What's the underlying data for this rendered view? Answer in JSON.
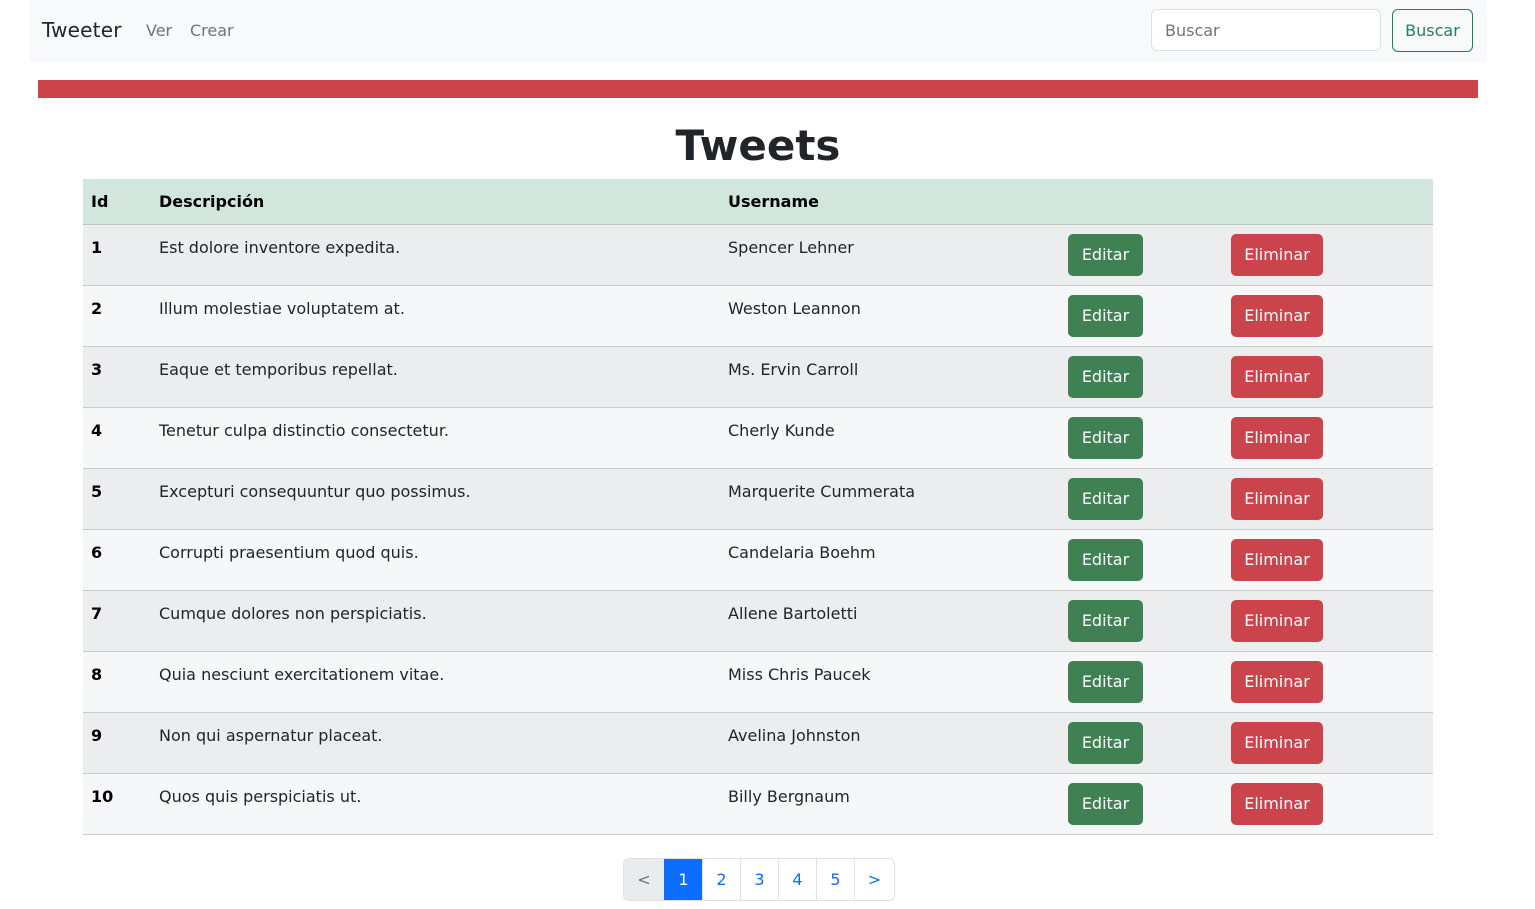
{
  "navbar": {
    "brand": "Tweeter",
    "links": [
      "Ver",
      "Crear"
    ],
    "search_placeholder": "Buscar",
    "search_button": "Buscar"
  },
  "colors": {
    "alert_bar": "#cc444b",
    "header_row": "#d3e6dd",
    "edit_button": "#3f8152",
    "delete_button": "#cc444b",
    "page_active": "#0d6efd"
  },
  "page_title": "Tweets",
  "table": {
    "headers": [
      "Id",
      "Descripción",
      "Username",
      "",
      ""
    ],
    "rows": [
      {
        "id": "1",
        "descripcion": "Est dolore inventore expedita.",
        "username": "Spencer Lehner",
        "edit": "Editar",
        "delete": "Eliminar"
      },
      {
        "id": "2",
        "descripcion": "Illum molestiae voluptatem at.",
        "username": "Weston Leannon",
        "edit": "Editar",
        "delete": "Eliminar"
      },
      {
        "id": "3",
        "descripcion": "Eaque et temporibus repellat.",
        "username": "Ms. Ervin Carroll",
        "edit": "Editar",
        "delete": "Eliminar"
      },
      {
        "id": "4",
        "descripcion": "Tenetur culpa distinctio consectetur.",
        "username": "Cherly Kunde",
        "edit": "Editar",
        "delete": "Eliminar"
      },
      {
        "id": "5",
        "descripcion": "Excepturi consequuntur quo possimus.",
        "username": "Marquerite Cummerata",
        "edit": "Editar",
        "delete": "Eliminar"
      },
      {
        "id": "6",
        "descripcion": "Corrupti praesentium quod quis.",
        "username": "Candelaria Boehm",
        "edit": "Editar",
        "delete": "Eliminar"
      },
      {
        "id": "7",
        "descripcion": "Cumque dolores non perspiciatis.",
        "username": "Allene Bartoletti",
        "edit": "Editar",
        "delete": "Eliminar"
      },
      {
        "id": "8",
        "descripcion": "Quia nesciunt exercitationem vitae.",
        "username": "Miss Chris Paucek",
        "edit": "Editar",
        "delete": "Eliminar"
      },
      {
        "id": "9",
        "descripcion": "Non qui aspernatur placeat.",
        "username": "Avelina Johnston",
        "edit": "Editar",
        "delete": "Eliminar"
      },
      {
        "id": "10",
        "descripcion": "Quos quis perspiciatis ut.",
        "username": "Billy Bergnaum",
        "edit": "Editar",
        "delete": "Eliminar"
      }
    ]
  },
  "pagination": {
    "prev": "<",
    "pages": [
      "1",
      "2",
      "3",
      "4",
      "5"
    ],
    "active": "1",
    "next": ">"
  }
}
